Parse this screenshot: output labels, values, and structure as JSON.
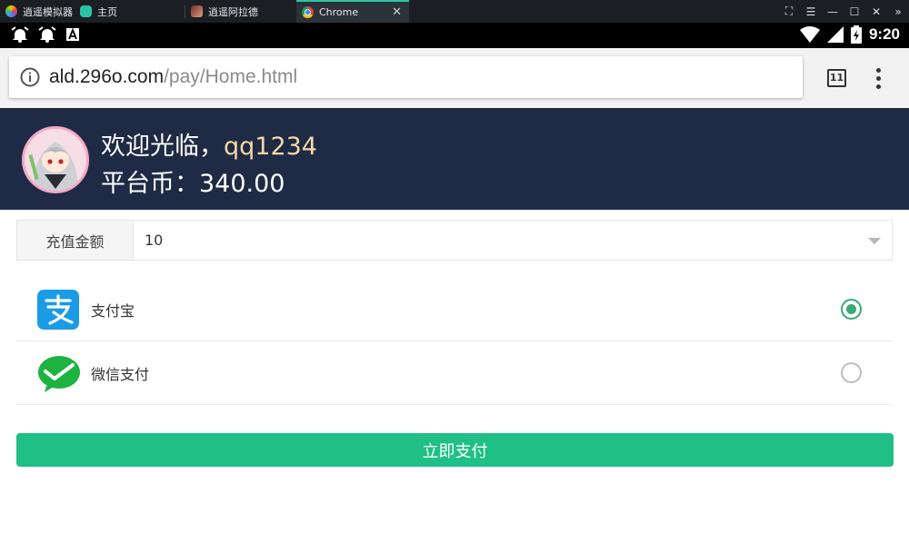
{
  "emulator": {
    "tabs": [
      {
        "label": "逍遥模拟器",
        "icon": "emulator-logo-icon"
      },
      {
        "label": "主页",
        "icon": "home-app-icon"
      },
      {
        "label": "逍遥阿拉德",
        "icon": "game-app-icon"
      },
      {
        "label": "Chrome",
        "icon": "chrome-icon"
      }
    ],
    "active_tab": "Chrome",
    "accent": "#2bc4a4"
  },
  "status_bar": {
    "time": "9:20",
    "icons": [
      "alarm-icon",
      "alarm-icon",
      "font-a-icon",
      "wifi-icon",
      "signal-icon",
      "battery-charging-icon"
    ]
  },
  "browser": {
    "url_host": "ald.296o.com",
    "url_path": "/pay/Home.html",
    "tab_count": "11"
  },
  "header": {
    "welcome_prefix": "欢迎光临，",
    "username": "qq1234",
    "coins_text": "平台币：340.00",
    "bg_color": "#1f2a45"
  },
  "form": {
    "amount_label": "充值金额",
    "amount_value": "10",
    "payment_methods": [
      {
        "name": "支付宝",
        "icon": "alipay-icon",
        "selected": true,
        "color": "#1a9be6"
      },
      {
        "name": "微信支付",
        "icon": "wechat-icon",
        "selected": false,
        "color": "#1cb341"
      }
    ],
    "submit_label": "立即支付",
    "submit_color": "#1fbf86"
  }
}
